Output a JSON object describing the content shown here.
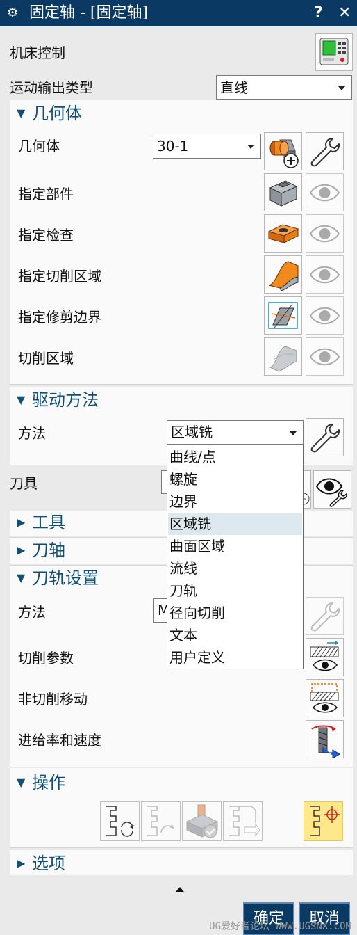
{
  "window": {
    "title": "固定轴 - [固定轴]",
    "help": "?",
    "close": "✕"
  },
  "machine": {
    "label": "机床控制"
  },
  "motion": {
    "label": "运动输出类型",
    "value": "直线"
  },
  "geometry": {
    "header": "几何体",
    "geometry_label": "几何体",
    "geometry_value": "30-1",
    "rows": [
      "指定部件",
      "指定检查",
      "指定切削区域",
      "指定修剪边界",
      "切削区域"
    ]
  },
  "drive": {
    "header": "驱动方法",
    "method_label": "方法",
    "method_value": "区域铣",
    "options": [
      "曲线/点",
      "螺旋",
      "边界",
      "区域铣",
      "曲面区域",
      "流线",
      "刀轨",
      "径向切削",
      "文本",
      "用户定义"
    ],
    "selected_index": 3
  },
  "tool": {
    "label": "刀具",
    "header": "工具"
  },
  "axis": {
    "header": "刀轴"
  },
  "path": {
    "header": "刀轨设置",
    "method_label": "方法",
    "method_value_partial": "M",
    "cut_params": "切削参数",
    "non_cut_moves": "非切削移动",
    "feeds": "进给率和速度"
  },
  "actions": {
    "header": "操作"
  },
  "options": {
    "header": "选项"
  },
  "buttons": {
    "ok": "确定",
    "cancel": "取消"
  },
  "watermark": "UG爱好者论坛 WWW.UGSNX.COM",
  "colors": {
    "title_bar": "#0a3a63",
    "section_header": "#0f4f78",
    "orange": "#f08a1c",
    "highlight": "#dde9ee",
    "gen_button_bg": "#ffe88a"
  }
}
